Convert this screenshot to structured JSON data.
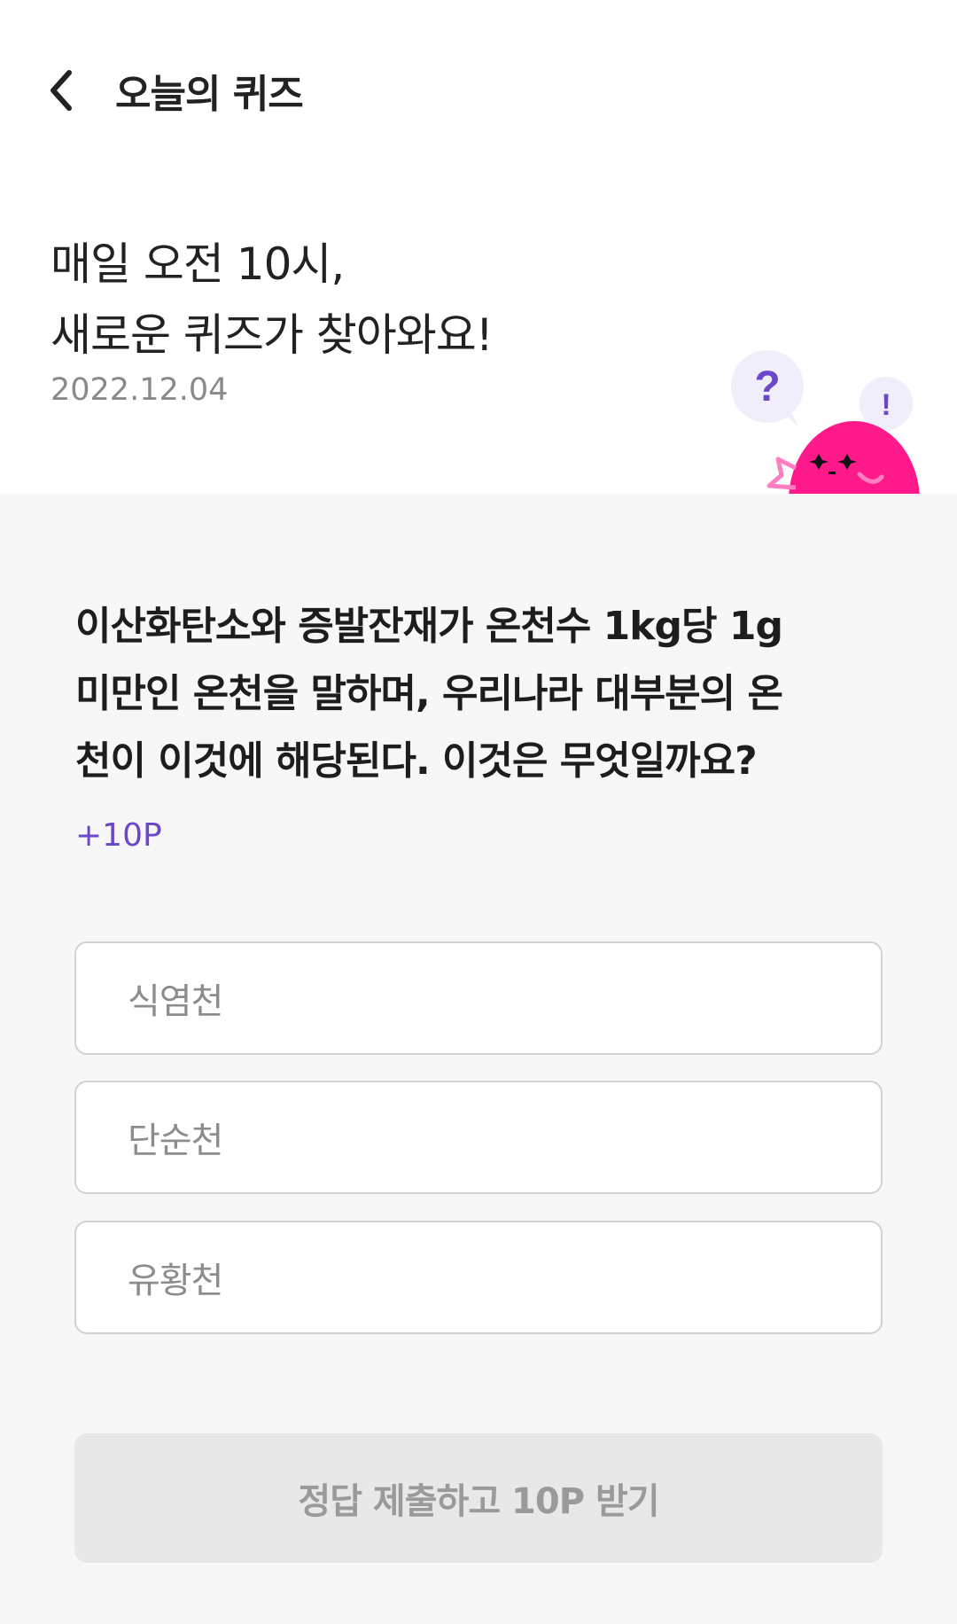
{
  "header": {
    "title": "오늘의 퀴즈",
    "back_icon": "chevron-left-icon"
  },
  "intro": {
    "line1": "매일 오전 10시,",
    "line2": "새로운 퀴즈가 찾아와요!",
    "date": "2022.12.04",
    "mascot": {
      "bubble_question": "?",
      "bubble_exclaim": "!",
      "body_color": "#ff1a8c",
      "bubble_color": "#efeefa",
      "question_color": "#6a48c7"
    }
  },
  "quiz": {
    "question_lines": [
      "이산화탄소와 증발잔재가 온천수 1kg당 1g",
      "미만인 온천을 말하며, 우리나라 대부분의 온",
      "천이 이것에 해당된다. 이것은 무엇일까요?"
    ],
    "reward": "+10P",
    "options": [
      {
        "label": "식염천"
      },
      {
        "label": "단순천"
      },
      {
        "label": "유황천"
      }
    ],
    "submit_label": "정답 제출하고 10P 받기"
  },
  "colors": {
    "accent": "#6a48c7",
    "mascot_pink": "#ff1a8c",
    "background_quiz": "#f7f7f7",
    "submit_disabled": "#e8e8e8"
  }
}
